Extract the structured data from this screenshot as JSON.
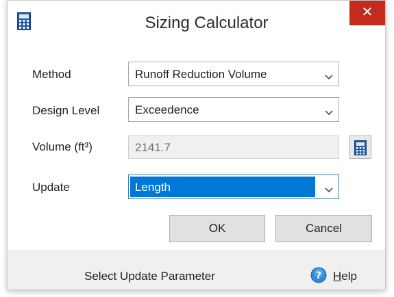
{
  "window": {
    "title": "Sizing Calculator",
    "title_icon": "calculator-icon",
    "close_glyph": "✕",
    "close_color": "#c42b1c"
  },
  "form": {
    "method": {
      "label": "Method",
      "value": "Runoff Reduction Volume"
    },
    "design_level": {
      "label": "Design Level",
      "value": "Exceedence"
    },
    "volume": {
      "label": "Volume (ft³)",
      "value": "2141.7",
      "button_icon": "calculator-icon"
    },
    "update": {
      "label": "Update",
      "value": "Length",
      "highlight_color": "#0078d7"
    }
  },
  "buttons": {
    "ok": "OK",
    "cancel": "Cancel"
  },
  "footer": {
    "status": "Select Update Parameter",
    "help_underlined": "H",
    "help_rest": "elp",
    "help_icon": "help-icon"
  }
}
